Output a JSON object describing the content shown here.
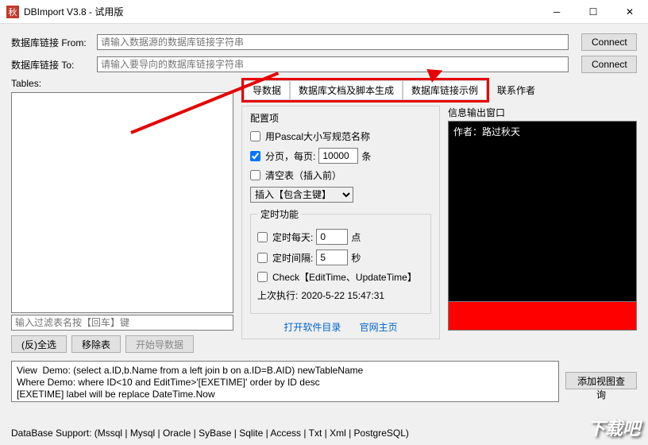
{
  "window": {
    "title": "DBImport V3.8 - 试用版",
    "icon_text": "秋"
  },
  "conn": {
    "from_label": "数据库链接 From:",
    "to_label": "数据库链接 To:",
    "from_placeholder": "请输入数据源的数据库链接字符串",
    "to_placeholder": "请输入要导向的数据库链接字符串",
    "connect_btn": "Connect"
  },
  "tables": {
    "label": "Tables:",
    "filter_placeholder": "输入过滤表名按【回车】键",
    "select_all_btn": "(反)全选",
    "remove_btn": "移除表",
    "start_btn": "开始导数据"
  },
  "tabs": {
    "t1": "导数据",
    "t2": "数据库文档及脚本生成",
    "t3": "数据库链接示例",
    "contact": "联系作者"
  },
  "config": {
    "title": "配置项",
    "pascal": "用Pascal大小写规范名称",
    "paging": "分页，每页:",
    "paging_value": "10000",
    "paging_unit": "条",
    "clear_table": "清空表（插入前）",
    "insert_mode": "插入【包含主键】"
  },
  "timer": {
    "title": "定时功能",
    "daily": "定时每天:",
    "daily_value": "0",
    "daily_unit": "点",
    "interval": "定时间隔:",
    "interval_value": "5",
    "interval_unit": "秒",
    "check": "Check【EditTime、UpdateTime】",
    "last_label": "上次执行:",
    "last_value": "2020-5-22 15:47:31"
  },
  "info": {
    "title": "信息输出窗口",
    "author": "作者：路过秋天"
  },
  "links": {
    "dir": "打开软件目录",
    "site": "官网主页"
  },
  "demo": {
    "line1": "View  Demo: (select a.ID,b.Name from a left join b on a.ID=B.AID) newTableName",
    "line2": "Where Demo: where ID<10 and EditTime>'[EXETIME]' order by ID desc",
    "line3": "[EXETIME] label will be replace DateTime.Now"
  },
  "add_view_btn": "添加视图查询",
  "status": "DataBase Support:     (Mssql | Mysql | Oracle | SyBase | Sqlite | Access | Txt | Xml | PostgreSQL)",
  "watermark": "下载吧"
}
